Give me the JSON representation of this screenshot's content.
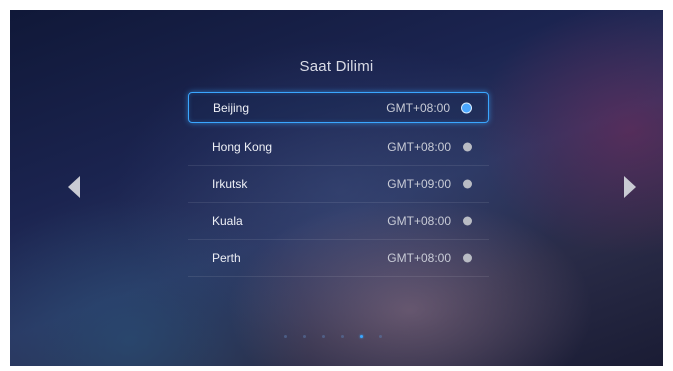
{
  "screen": {
    "title": "Saat Dilimi"
  },
  "timezones": [
    {
      "city": "Beijing",
      "offset": "GMT+08:00",
      "selected": true
    },
    {
      "city": "Hong Kong",
      "offset": "GMT+08:00",
      "selected": false
    },
    {
      "city": "Irkutsk",
      "offset": "GMT+09:00",
      "selected": false
    },
    {
      "city": "Kuala",
      "offset": "GMT+08:00",
      "selected": false
    },
    {
      "city": "Perth",
      "offset": "GMT+08:00",
      "selected": false
    }
  ],
  "navigation": {
    "prev_icon": "chevron-left-icon",
    "next_icon": "chevron-right-icon"
  },
  "pager": {
    "pages": 6,
    "current_page": 5
  },
  "colors": {
    "accent": "#3aa6ff",
    "radio_off": "#b9bcc4"
  }
}
